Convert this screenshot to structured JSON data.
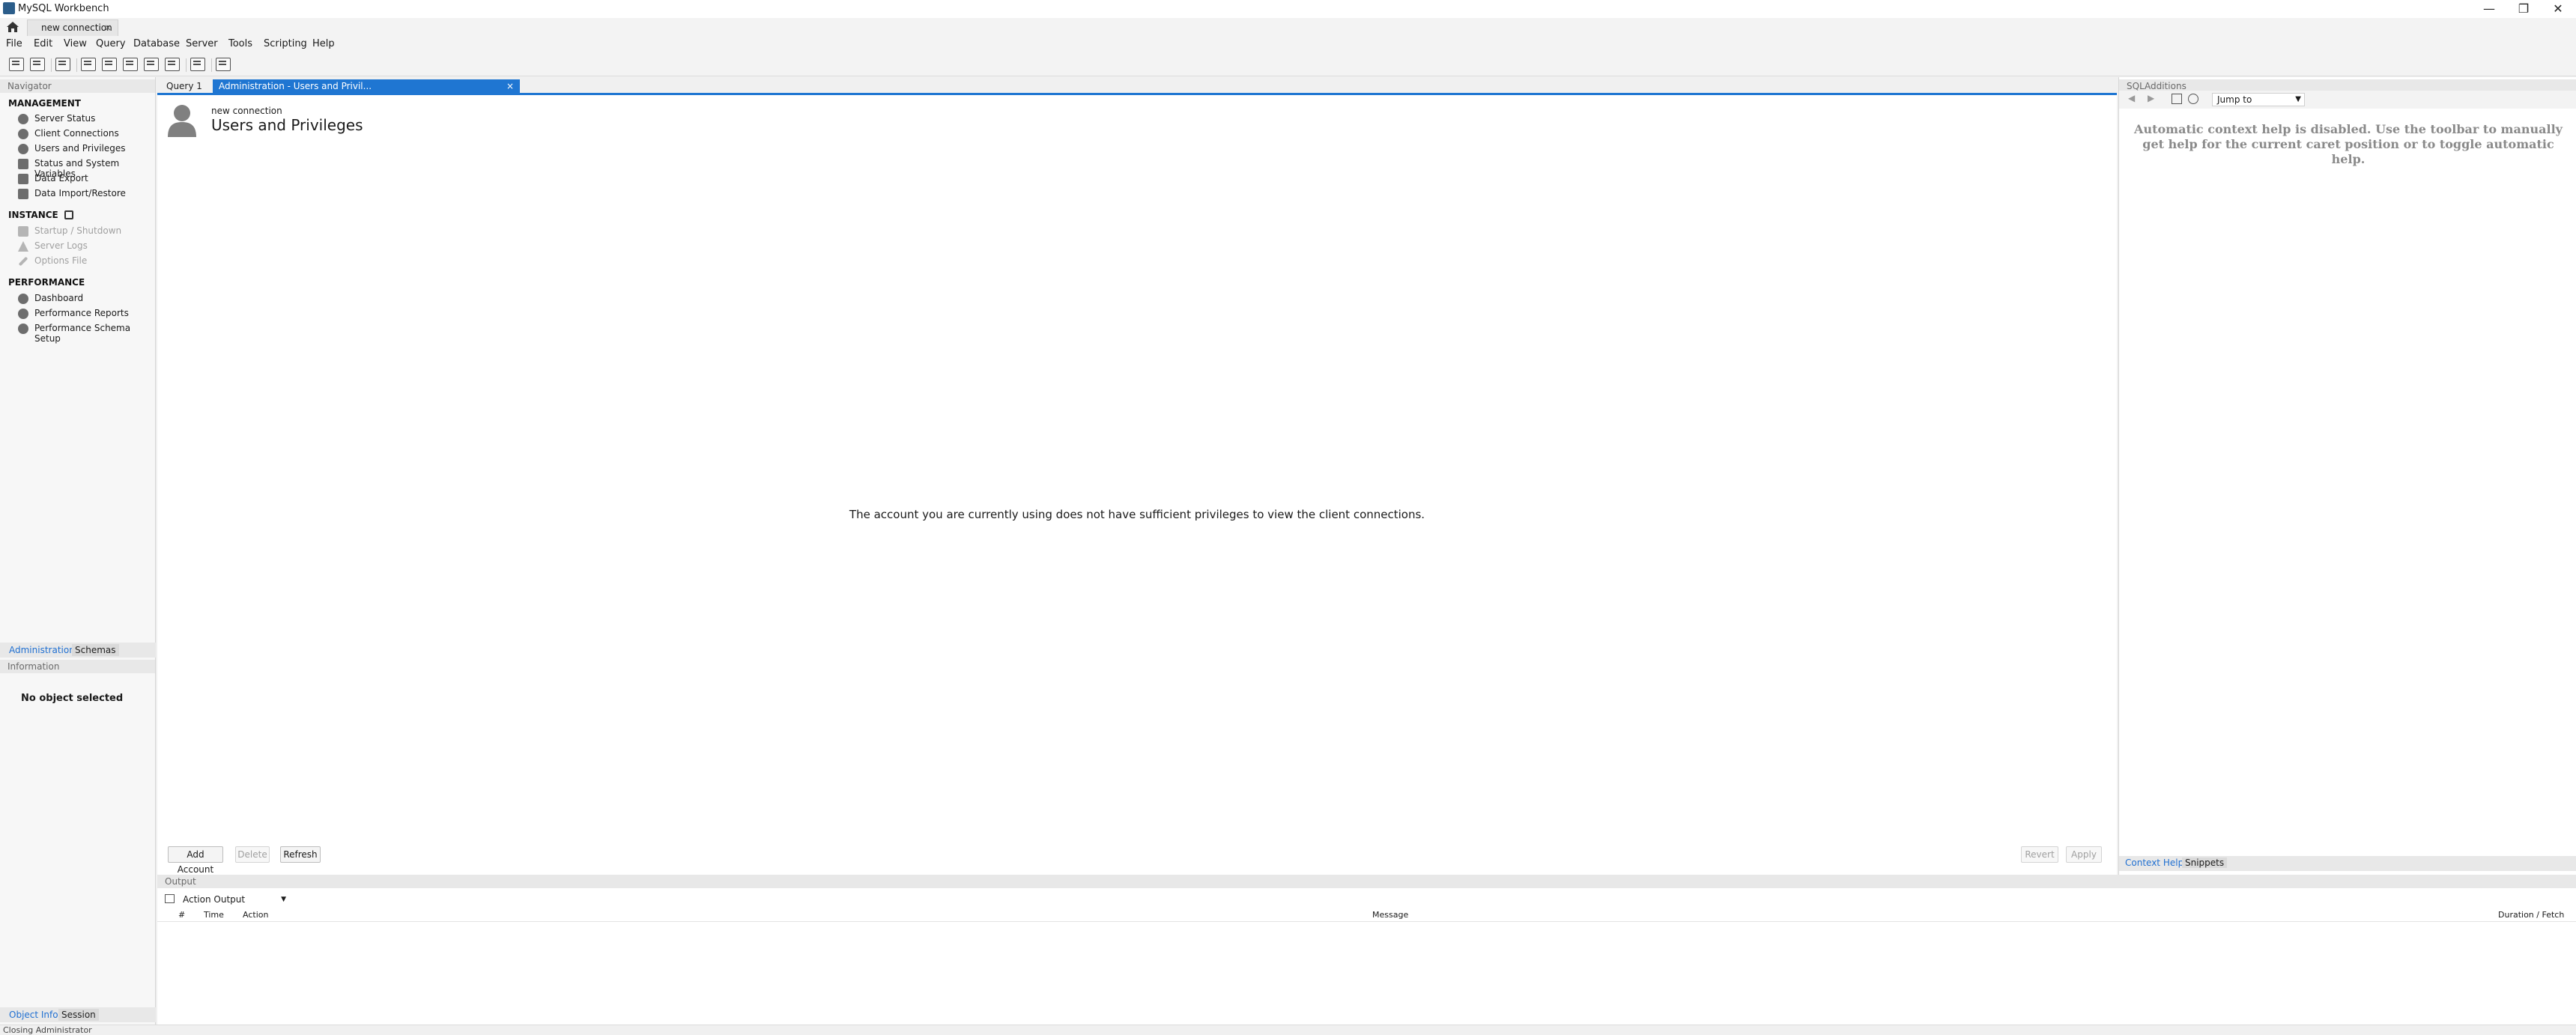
{
  "window": {
    "title": "MySQL Workbench",
    "minimize": "—",
    "restore": "❐",
    "close": "✕"
  },
  "connection_tab": {
    "label": "new connection",
    "close": "×"
  },
  "menu": [
    "File",
    "Edit",
    "View",
    "Query",
    "Database",
    "Server",
    "Tools",
    "Scripting",
    "Help"
  ],
  "navigator": {
    "header": "Navigator",
    "management_header": "MANAGEMENT",
    "management": [
      "Server Status",
      "Client Connections",
      "Users and Privileges",
      "Status and System Variables",
      "Data Export",
      "Data Import/Restore"
    ],
    "instance_header": "INSTANCE",
    "instance": [
      "Startup / Shutdown",
      "Server Logs",
      "Options File"
    ],
    "performance_header": "PERFORMANCE",
    "performance": [
      "Dashboard",
      "Performance Reports",
      "Performance Schema Setup"
    ],
    "tabs": {
      "administration": "Administration",
      "schemas": "Schemas"
    },
    "information_header": "Information",
    "no_object": "No object selected",
    "info_tabs": {
      "object_info": "Object Info",
      "session": "Session"
    }
  },
  "editor": {
    "tab_query": "Query 1",
    "tab_admin": "Administration - Users and Privil...",
    "tab_close": "×",
    "subtitle": "new connection",
    "title": "Users and Privileges",
    "message": "The account you are currently using does not have sufficient privileges to view the client connections.",
    "buttons": {
      "add_account": "Add Account",
      "delete": "Delete",
      "refresh": "Refresh",
      "revert": "Revert",
      "apply": "Apply"
    }
  },
  "sql_additions": {
    "header": "SQLAdditions",
    "jump_to": "Jump to",
    "help_message": "Automatic context help is disabled. Use the toolbar to manually get help for the current caret position or to toggle automatic help.",
    "tabs": {
      "context_help": "Context Help",
      "snippets": "Snippets"
    }
  },
  "output": {
    "header": "Output",
    "selector": "Action Output",
    "columns": {
      "num": "#",
      "time": "Time",
      "action": "Action",
      "message": "Message",
      "duration": "Duration / Fetch"
    }
  },
  "status": {
    "text": "Closing Administrator"
  },
  "colors": {
    "accent": "#1f76d2",
    "active_tab_text": "#ffffff",
    "link": "#1f6fd1"
  }
}
